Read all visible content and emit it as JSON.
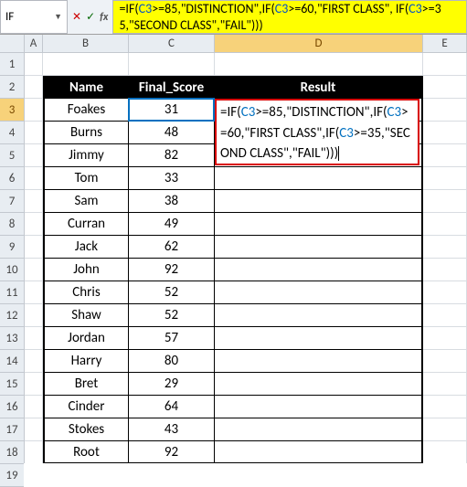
{
  "nameBox": "IF",
  "formulaBar": {
    "prefix": "=IF(",
    "ref1": "C3",
    "mid1": ">=85,\"DISTINCTION\",IF(",
    "ref2": "C3",
    "mid2": ">=60,\"FIRST CLASS\", IF(",
    "ref3": "C3",
    "tail": ">=35,\"SECOND CLASS\",\"FAIL\")))"
  },
  "colLabels": {
    "A": "A",
    "B": "B",
    "C": "C",
    "D": "D",
    "E": "E"
  },
  "rowLabels": [
    "1",
    "2",
    "3",
    "4",
    "5",
    "6",
    "7",
    "8",
    "9",
    "10",
    "11",
    "12",
    "13",
    "14",
    "15",
    "16",
    "17",
    "18",
    "19"
  ],
  "headers": {
    "name": "Name",
    "score": "Final_Score",
    "result": "Result"
  },
  "rows": [
    {
      "name": "Foakes",
      "score": "31"
    },
    {
      "name": "Burns",
      "score": "48"
    },
    {
      "name": "Jimmy",
      "score": "82"
    },
    {
      "name": "Tom",
      "score": "33"
    },
    {
      "name": "Sam",
      "score": "38"
    },
    {
      "name": "Curran",
      "score": "49"
    },
    {
      "name": "Jack",
      "score": "62"
    },
    {
      "name": "John",
      "score": "92"
    },
    {
      "name": "Chris",
      "score": "52"
    },
    {
      "name": "Shaw",
      "score": "52"
    },
    {
      "name": "Jordan",
      "score": "57"
    },
    {
      "name": "Harry",
      "score": "80"
    },
    {
      "name": "Bret",
      "score": "29"
    },
    {
      "name": "Cinder",
      "score": "64"
    },
    {
      "name": "Stokes",
      "score": "43"
    },
    {
      "name": "Root",
      "score": "92"
    }
  ],
  "editFormula": {
    "p1": "=IF(",
    "r1": "C3",
    "p2": ">=85,\"DISTINCTION\",IF(",
    "r2": "C3",
    "p3": ">=60,\"FIRST CLASS\",IF(",
    "r3": "C3",
    "p4": ">=35,\"SECOND CLASS\",\"FAIL\")))"
  }
}
